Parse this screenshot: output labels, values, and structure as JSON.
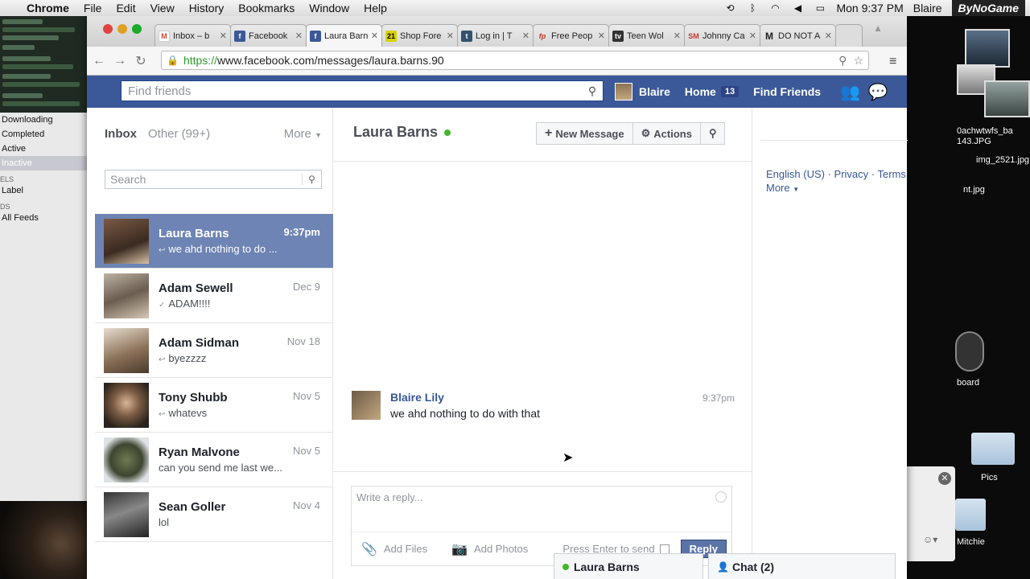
{
  "menubar": {
    "app": "Chrome",
    "items": [
      "File",
      "Edit",
      "View",
      "History",
      "Bookmarks",
      "Window",
      "Help"
    ],
    "clock": "Mon 9:37 PM",
    "user": "Blaire",
    "brand": "ByNoGame"
  },
  "left_app": {
    "items": [
      "Downloading",
      "Completed",
      "Active",
      "Inactive"
    ],
    "sec_labels": "ELS",
    "label_item": "Label",
    "sec_feeds": "DS",
    "feeds_item": "All Feeds"
  },
  "desktop": {
    "files": [
      "0achwtwfs_ba 143.JPG",
      "img_2521.jpg",
      "nt.jpg"
    ],
    "board": "board",
    "pics": "Pics",
    "mitchie": "Mitchie"
  },
  "browser": {
    "tabs": [
      {
        "title": "Inbox – b",
        "fav": "M",
        "color": "#d14836"
      },
      {
        "title": "Facebook",
        "fav": "f",
        "color": "#3b5998"
      },
      {
        "title": "Laura Barn",
        "fav": "f",
        "color": "#3b5998"
      },
      {
        "title": "Shop Fore",
        "fav": "21",
        "color": "#d8d200"
      },
      {
        "title": "Log in | T",
        "fav": "t",
        "color": "#34526f"
      },
      {
        "title": "Free Peop",
        "fav": "fp",
        "color": "#ffffff"
      },
      {
        "title": "Teen Wol",
        "fav": "tv",
        "color": "#333333"
      },
      {
        "title": "Johnny Ca",
        "fav": "SM",
        "color": "#ffffff"
      },
      {
        "title": "DO NOT A",
        "fav": "M",
        "color": "#ffffff"
      }
    ],
    "url_scheme": "https://",
    "url_rest": "www.facebook.com/messages/laura.barns.90"
  },
  "fb": {
    "search_placeholder": "Find friends",
    "user": "Blaire",
    "home": "Home",
    "home_count": "13",
    "find_friends": "Find Friends"
  },
  "inbox": {
    "tab_inbox": "Inbox",
    "tab_other": "Other (99+)",
    "more": "More",
    "search_placeholder": "Search",
    "threads": [
      {
        "name": "Laura Barns",
        "snippet": "we ahd nothing to do ...",
        "date": "9:37pm"
      },
      {
        "name": "Adam Sewell",
        "snippet": "ADAM!!!!",
        "date": "Dec 9"
      },
      {
        "name": "Adam Sidman",
        "snippet": "byezzzz",
        "date": "Nov 18"
      },
      {
        "name": "Tony Shubb",
        "snippet": "whatevs",
        "date": "Nov 5"
      },
      {
        "name": "Ryan Malvone",
        "snippet": "can you send me last we...",
        "date": "Nov 5"
      },
      {
        "name": "Sean Goller",
        "snippet": "lol",
        "date": "Nov 4"
      }
    ]
  },
  "conversation": {
    "name": "Laura Barns",
    "new_message": "New Message",
    "actions": "Actions",
    "message_author": "Blaire Lily",
    "message_text": "we ahd nothing to do with that",
    "message_time": "9:37pm",
    "reply_placeholder": "Write a reply...",
    "add_files": "Add Files",
    "add_photos": "Add Photos",
    "press_enter": "Press Enter to send",
    "reply_button": "Reply"
  },
  "footer": {
    "language": "English (US)",
    "privacy": "Privacy",
    "terms": "Terms",
    "more": "More"
  },
  "chat": {
    "tab1": "Laura Barns",
    "tab2": "Chat (2)"
  }
}
